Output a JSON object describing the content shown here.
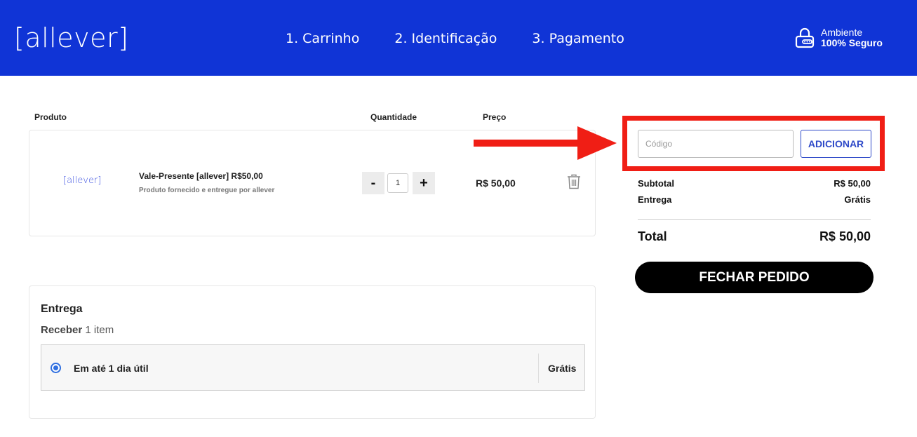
{
  "header": {
    "logo": "[allever]",
    "steps": [
      "1. Carrinho",
      "2. Identificação",
      "3. Pagamento"
    ],
    "secure_line1": "Ambiente",
    "secure_line2": "100% Seguro",
    "bg_color": "#1034d6"
  },
  "cart": {
    "columns": {
      "product": "Produto",
      "quantity": "Quantidade",
      "price": "Preço"
    },
    "item": {
      "logo": "[allever]",
      "name": "Vale-Presente [allever] R$50,00",
      "subtitle": "Produto fornecido e entregue por allever",
      "minus": "-",
      "plus": "+",
      "quantity": "1",
      "price": "R$ 50,00"
    }
  },
  "delivery": {
    "title": "Entrega",
    "receive_label": "Receber",
    "receive_count": "1 item",
    "option_label": "Em até 1 dia útil",
    "option_price": "Grátis"
  },
  "summary": {
    "coupon_placeholder": "Código",
    "coupon_button": "ADICIONAR",
    "subtotal_label": "Subtotal",
    "subtotal_value": "R$ 50,00",
    "shipping_label": "Entrega",
    "shipping_value": "Grátis",
    "total_label": "Total",
    "total_value": "R$ 50,00",
    "checkout_button": "FECHAR PEDIDO",
    "highlight_color": "#f01e15"
  }
}
